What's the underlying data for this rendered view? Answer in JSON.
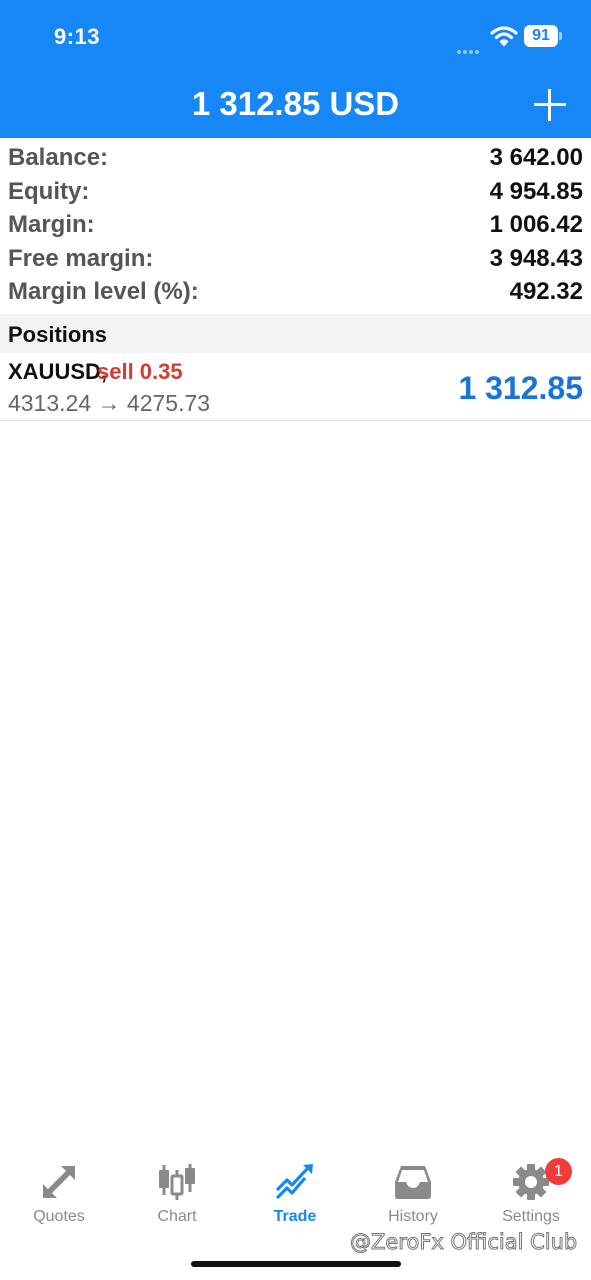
{
  "status_bar": {
    "time": "9:13",
    "battery": "91"
  },
  "header": {
    "title": "1 312.85 USD"
  },
  "summary": [
    {
      "label": "Balance:",
      "value": "3 642.00"
    },
    {
      "label": "Equity:",
      "value": "4 954.85"
    },
    {
      "label": "Margin:",
      "value": "1 006.42"
    },
    {
      "label": "Free margin:",
      "value": "3 948.43"
    },
    {
      "label": "Margin level (%):",
      "value": "492.32"
    }
  ],
  "positions": {
    "title": "Positions",
    "items": [
      {
        "symbol": "XAUUSD,",
        "side": "sell 0.35",
        "prices": "4313.24 → 4275.73",
        "profit": "1 312.85"
      }
    ]
  },
  "tabs": [
    {
      "label": "Quotes",
      "icon": "quotes-arrows-icon"
    },
    {
      "label": "Chart",
      "icon": "candlestick-chart-icon"
    },
    {
      "label": "Trade",
      "icon": "trade-trend-icon",
      "active": true
    },
    {
      "label": "History",
      "icon": "inbox-tray-icon"
    },
    {
      "label": "Settings",
      "icon": "gear-icon",
      "badge": "1"
    }
  ],
  "watermark": "@ZeroFx Official Club",
  "colors": {
    "accent": "#1787f5",
    "sell": "#d63b2f",
    "profit": "#1a73d9",
    "badge": "#f03b3b"
  }
}
